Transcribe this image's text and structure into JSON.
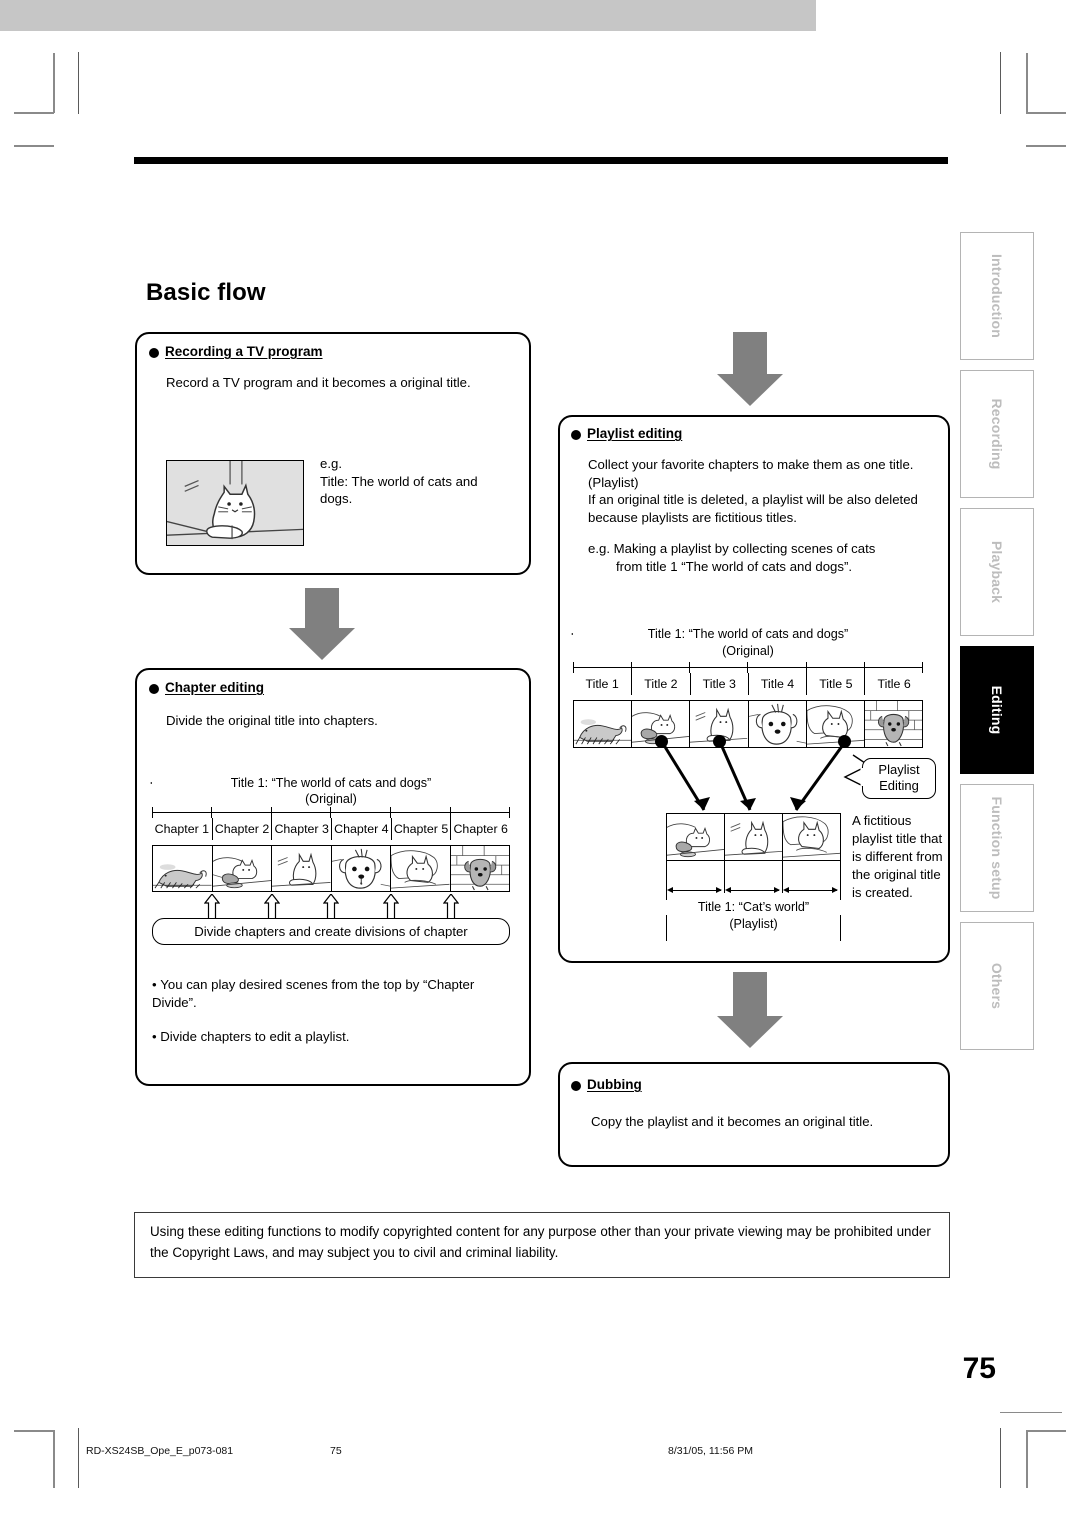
{
  "page": {
    "heading": "Basic flow",
    "number": "75"
  },
  "sections": {
    "recording": {
      "title": "Recording a TV program",
      "body": "Record a TV program and it becomes a original title.",
      "example_lines": "e.g.\nTitle: The world of cats and\ndogs.",
      "thumbnail_name": "cat-sitting-illustration"
    },
    "chapter": {
      "title": "Chapter editing",
      "body": "Divide the original title into chapters.",
      "timeline_title": "Title 1: “The world of cats and dogs”",
      "timeline_subtitle": "(Original)",
      "segments": [
        "Chapter 1",
        "Chapter 2",
        "Chapter 3",
        "Chapter 4",
        "Chapter 5",
        "Chapter 6"
      ],
      "pill": "Divide chapters and create divisions of chapter",
      "bullets": [
        "You can play desired scenes from the top by “Chapter Divide”.",
        "Divide chapters to edit a playlist."
      ]
    },
    "playlist": {
      "title": "Playlist editing",
      "body_p1": "Collect your favorite chapters to make them as one title. (Playlist)",
      "body_p2": "If an original title is deleted, a playlist will be also deleted because playlists are fictitious titles.",
      "body_p3": "e.g. Making a playlist by collecting scenes of cats",
      "body_p3b": "from title 1 “The world of cats and dogs”.",
      "timeline_title": "Title 1: “The world of cats and dogs”",
      "timeline_subtitle": "(Original)",
      "segments": [
        "Title 1",
        "Title 2",
        "Title 3",
        "Title 4",
        "Title 5",
        "Title 6"
      ],
      "callout": "Playlist\nEditing",
      "callout_line1": "Playlist",
      "callout_line2": "Editing",
      "result_title": "Title 1: “Cat’s world”",
      "result_subtitle": "(Playlist)",
      "side_note": "A fictitious playlist title that is different from the original title is created."
    },
    "dubbing": {
      "title": "Dubbing",
      "body": "Copy the playlist and it becomes an original title."
    }
  },
  "notice": "Using these editing functions to modify copyrighted content for any purpose other than your private viewing may be prohibited under the Copyright Laws, and may subject you to civil and criminal liability.",
  "side_tabs": [
    {
      "label": "Introduction",
      "active": false
    },
    {
      "label": "Recording",
      "active": false
    },
    {
      "label": "Playback",
      "active": false
    },
    {
      "label": "Editing",
      "active": true
    },
    {
      "label": "Function setup",
      "active": false
    },
    {
      "label": "Others",
      "active": false
    }
  ],
  "footer": {
    "file": "RD-XS24SB_Ope_E_p073-081",
    "page": "75",
    "date": "8/31/05, 11:56 PM"
  },
  "colors": {
    "heading_bar": "#c6c6c6",
    "flow_arrow": "#808080",
    "active_tab_bg": "#000000",
    "tab_label": "#bdbdbd"
  }
}
